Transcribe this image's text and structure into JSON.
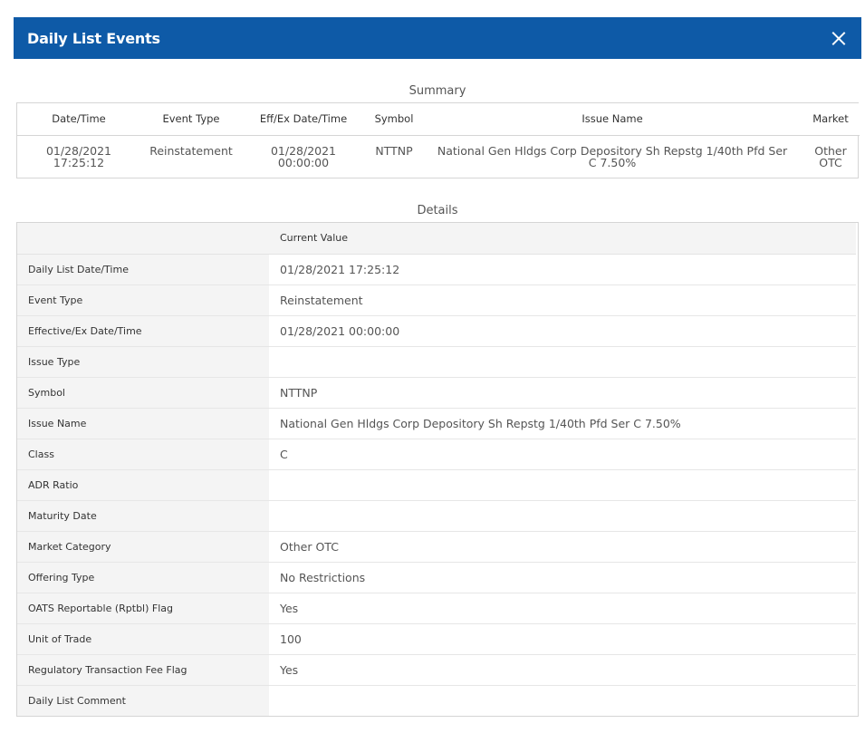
{
  "dialog": {
    "title": "Daily List Events",
    "close_icon": "close-icon"
  },
  "summary": {
    "caption": "Summary",
    "columns": [
      "Date/Time",
      "Event Type",
      "Eff/Ex Date/Time",
      "Symbol",
      "Issue Name",
      "Market"
    ],
    "rows": [
      {
        "date_line1": "01/28/2021",
        "date_line2": "17:25:12",
        "event_type": "Reinstatement",
        "eff_line1": "01/28/2021",
        "eff_line2": "00:00:00",
        "symbol": "NTTNP",
        "issue_line1": "National Gen Hldgs Corp Depository Sh Repstg 1/40th Pfd Ser",
        "issue_line2": "C 7.50%",
        "market_line1": "Other",
        "market_line2": "OTC"
      }
    ]
  },
  "details": {
    "caption": "Details",
    "header_label": "",
    "header_value": "Current Value",
    "rows": [
      {
        "label": "Daily List Date/Time",
        "value": "01/28/2021 17:25:12"
      },
      {
        "label": "Event Type",
        "value": "Reinstatement"
      },
      {
        "label": "Effective/Ex Date/Time",
        "value": "01/28/2021 00:00:00"
      },
      {
        "label": "Issue Type",
        "value": ""
      },
      {
        "label": "Symbol",
        "value": "NTTNP"
      },
      {
        "label": "Issue Name",
        "value": "National Gen Hldgs Corp Depository Sh Repstg 1/40th Pfd Ser C 7.50%"
      },
      {
        "label": "Class",
        "value": "C"
      },
      {
        "label": "ADR Ratio",
        "value": ""
      },
      {
        "label": "Maturity Date",
        "value": ""
      },
      {
        "label": "Market Category",
        "value": "Other OTC"
      },
      {
        "label": "Offering Type",
        "value": "No Restrictions"
      },
      {
        "label": "OATS Reportable (Rptbl) Flag",
        "value": "Yes"
      },
      {
        "label": "Unit of Trade",
        "value": "100"
      },
      {
        "label": "Regulatory Transaction Fee Flag",
        "value": "Yes"
      },
      {
        "label": "Daily List Comment",
        "value": ""
      }
    ]
  },
  "colors": {
    "titlebar": "#0e5aa7",
    "label_bg": "#f4f4f4",
    "border": "#d5d5d5"
  }
}
